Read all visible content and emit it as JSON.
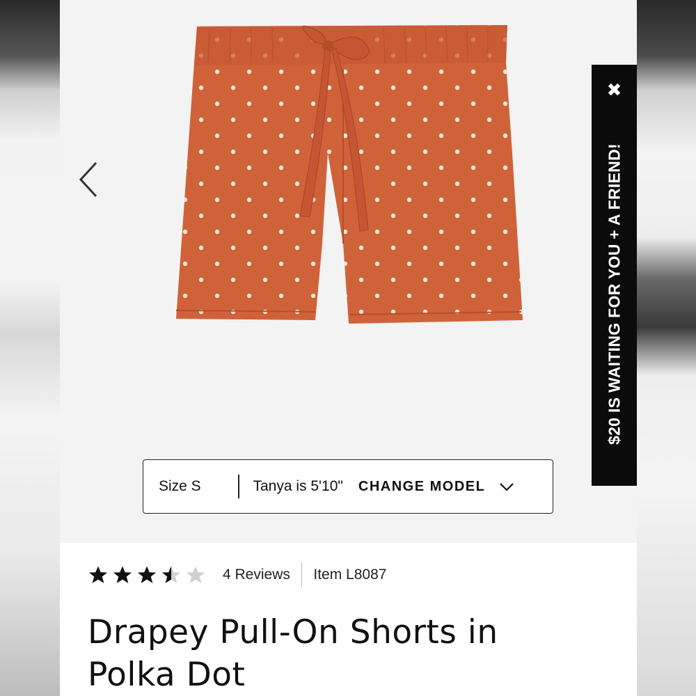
{
  "colors": {
    "accent": "#d0623a",
    "dot": "#f3e6d6",
    "promo_bg": "#0b0b0b"
  },
  "gallery": {
    "product_image_alt": "orange polka dot shorts",
    "prev_icon": "chevron-left-icon"
  },
  "model_bar": {
    "size_label": "Size S",
    "model_text": "Tanya is 5'10\"",
    "change_model_label": "CHANGE MODEL",
    "dropdown_icon": "chevron-down-icon"
  },
  "rating": {
    "value": 3.5,
    "max": 5
  },
  "reviews_label": "4 Reviews",
  "item_code": "Item L8087",
  "product_title": "Drapey Pull-On Shorts in Polka Dot",
  "promo": {
    "text": "$20 IS WAITING FOR YOU + A FRIEND!",
    "close_icon": "close-icon"
  }
}
